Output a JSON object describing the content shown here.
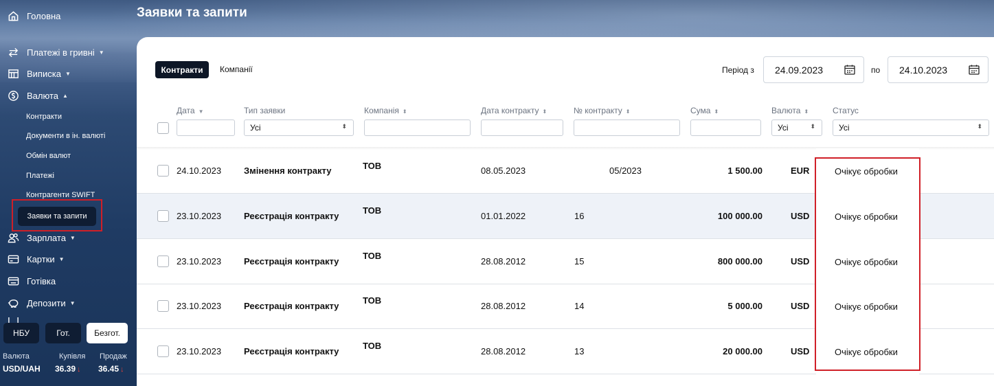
{
  "page_title": "Заявки та запити",
  "sidebar": {
    "home": "Головна",
    "payments_uah": "Платежі в гривні",
    "statement": "Виписка",
    "currency": "Валюта",
    "currency_sub": [
      "Контракти",
      "Документи в ін. валюті",
      "Обмін валют",
      "Платежі",
      "Контрагенти SWIFT",
      "Заявки та запити"
    ],
    "salary": "Зарплата",
    "cards": "Картки",
    "cash": "Готівка",
    "deposits": "Депозити"
  },
  "fx": {
    "tabs": [
      "НБУ",
      "Гот.",
      "Безгот."
    ],
    "active_tab": "Безгот.",
    "header_currency": "Валюта",
    "header_buy": "Купівля",
    "header_sell": "Продаж",
    "pair": "USD/UAH",
    "buy": "36.39",
    "sell": "36.45",
    "trend_down_color": "#e2413c"
  },
  "tabs": {
    "contracts": "Контракти",
    "companies": "Компанії",
    "active": "Контракти"
  },
  "period": {
    "from_label": "Період з",
    "from": "24.09.2023",
    "to_label": "по",
    "to": "24.10.2023"
  },
  "columns": {
    "date": "Дата",
    "type": "Тип заявки",
    "company": "Компанія",
    "contract_date": "Дата контракту",
    "contract_no": "№ контракту",
    "amount": "Сума",
    "currency": "Валюта",
    "status": "Статус"
  },
  "filters": {
    "type": "Усі",
    "currency": "Усі",
    "status": "Усі"
  },
  "rows": [
    {
      "date": "24.10.2023",
      "type": "Змінення контракту",
      "company": "ТОВ",
      "contract_date": "08.05.2023",
      "contract_no": "05/2023",
      "amount": "1 500.00",
      "currency": "EUR",
      "status": "Очікує обробки"
    },
    {
      "date": "23.10.2023",
      "type": "Реєстрація контракту",
      "company": "ТОВ",
      "contract_date": "01.01.2022",
      "contract_no": "16",
      "amount": "100 000.00",
      "currency": "USD",
      "status": "Очікує обробки"
    },
    {
      "date": "23.10.2023",
      "type": "Реєстрація контракту",
      "company": "ТОВ",
      "contract_date": "28.08.2012",
      "contract_no": "15",
      "amount": "800 000.00",
      "currency": "USD",
      "status": "Очікує обробки"
    },
    {
      "date": "23.10.2023",
      "type": "Реєстрація контракту",
      "company": "ТОВ",
      "contract_date": "28.08.2012",
      "contract_no": "14",
      "amount": "5 000.00",
      "currency": "USD",
      "status": "Очікує обробки"
    },
    {
      "date": "23.10.2023",
      "type": "Реєстрація контракту",
      "company": "ТОВ",
      "contract_date": "28.08.2012",
      "contract_no": "13",
      "amount": "20 000.00",
      "currency": "USD",
      "status": "Очікує обробки"
    }
  ],
  "highlight_color": "#d01f27"
}
